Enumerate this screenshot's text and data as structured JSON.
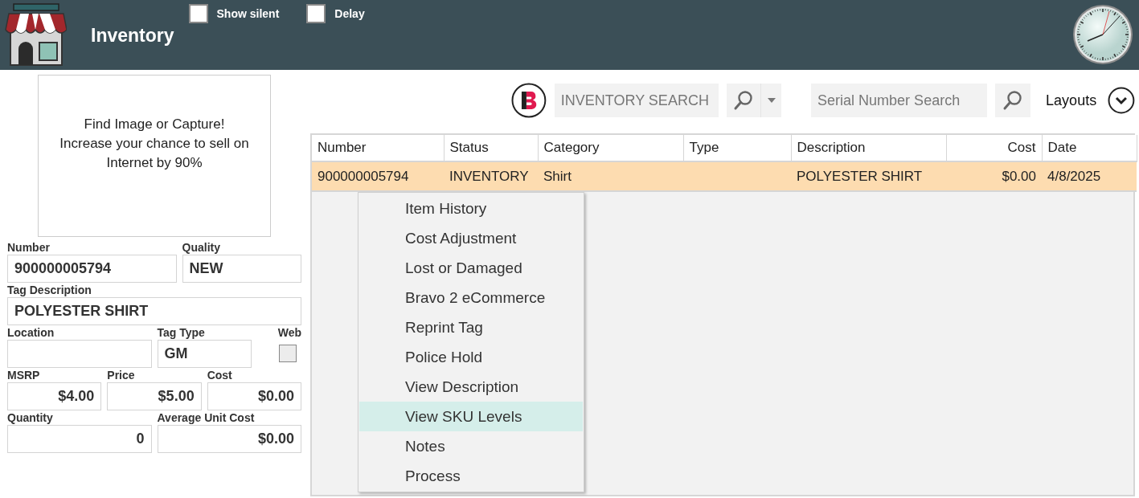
{
  "header": {
    "title": "Inventory",
    "options": [
      {
        "label": "Show silent",
        "checked": false
      },
      {
        "label": "Delay",
        "checked": false
      }
    ]
  },
  "image_prompt": {
    "lines": [
      "Find Image or Capture!",
      "Increase your chance to sell on",
      "Internet by 90%"
    ]
  },
  "form": {
    "rows": [
      [
        {
          "label": "Number",
          "value": "900000005794",
          "kind": "text"
        },
        {
          "label": "Quality",
          "value": "NEW",
          "kind": "text"
        }
      ],
      [
        {
          "label": "Tag Description",
          "value": "POLYESTER SHIRT",
          "kind": "text"
        }
      ],
      [
        {
          "label": "Location",
          "kind": "text"
        },
        {
          "label": "Tag Type",
          "value": "GM",
          "kind": "text"
        },
        {
          "label": "Web",
          "kind": "checkbox",
          "checked": false
        }
      ],
      [
        {
          "label": "MSRP",
          "value": "$4.00",
          "kind": "number"
        },
        {
          "label": "Price",
          "value": "$5.00",
          "kind": "number"
        },
        {
          "label": "Cost",
          "value": "$0.00",
          "kind": "number"
        }
      ],
      [
        {
          "label": "Quantity",
          "value": "0",
          "kind": "number"
        },
        {
          "label": "Average Unit Cost",
          "value": "$0.00",
          "kind": "number"
        }
      ]
    ]
  },
  "search": {
    "placeholder": "INVENTORY SEARCH"
  },
  "serial_search": {
    "placeholder": "Serial Number Search"
  },
  "layouts": {
    "label": "Layouts"
  },
  "table": {
    "columns": [
      {
        "label": "Number",
        "kind": "text"
      },
      {
        "label": "Status",
        "kind": "text"
      },
      {
        "label": "Category",
        "kind": "text"
      },
      {
        "label": "Type",
        "kind": "text"
      },
      {
        "label": "Description",
        "kind": "text"
      },
      {
        "label": "Cost",
        "kind": "number"
      },
      {
        "label": "Date",
        "kind": "text"
      }
    ],
    "rows": [
      {
        "selected": true,
        "cells": [
          "900000005794",
          "INVENTORY",
          "Shirt",
          "",
          "POLYESTER SHIRT",
          "$0.00",
          "4/8/2025"
        ]
      }
    ]
  },
  "context_menu": {
    "items": [
      {
        "label": "Item History",
        "selected": false
      },
      {
        "label": "Cost Adjustment",
        "selected": false
      },
      {
        "label": "Lost or Damaged",
        "selected": false
      },
      {
        "label": "Bravo 2 eCommerce",
        "selected": false
      },
      {
        "label": "Reprint Tag",
        "selected": false
      },
      {
        "label": "Police Hold",
        "selected": false
      },
      {
        "label": "View Description",
        "selected": false
      },
      {
        "label": "View SKU Levels",
        "selected": true
      },
      {
        "label": "Notes",
        "selected": false
      },
      {
        "label": "Process",
        "selected": false
      }
    ]
  }
}
